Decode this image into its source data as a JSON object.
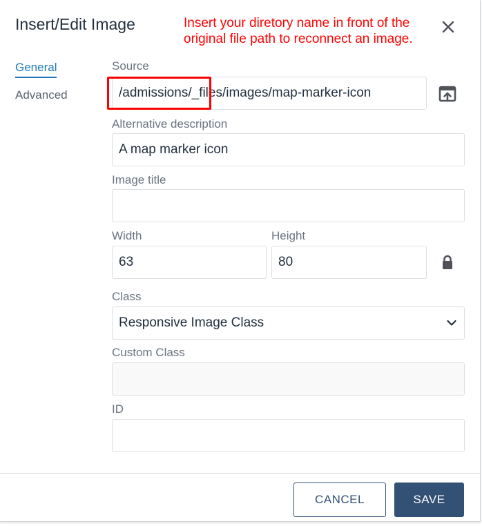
{
  "dialog": {
    "title": "Insert/Edit Image",
    "close_icon": "close-icon"
  },
  "annotation": {
    "text": "Insert your diretory name in front of the original file path to reconnect an image.",
    "color": "#ff0000"
  },
  "tabs": [
    {
      "label": "General",
      "active": true
    },
    {
      "label": "Advanced",
      "active": false
    }
  ],
  "form": {
    "source": {
      "label": "Source",
      "value": "/admissions/_files/images/map-marker-icon",
      "browse_icon": "upload-icon"
    },
    "alt": {
      "label": "Alternative description",
      "value": "A map marker icon"
    },
    "title": {
      "label": "Image title",
      "value": ""
    },
    "width": {
      "label": "Width",
      "value": "63"
    },
    "height": {
      "label": "Height",
      "value": "80"
    },
    "constrain_icon": "lock-icon",
    "class": {
      "label": "Class",
      "value": "Responsive Image Class"
    },
    "custom_class": {
      "label": "Custom Class",
      "value": ""
    },
    "id": {
      "label": "ID",
      "value": ""
    }
  },
  "footer": {
    "cancel_label": "CANCEL",
    "save_label": "SAVE"
  },
  "colors": {
    "accent": "#207ab7",
    "primary_button": "#335075",
    "text": "#222f3e",
    "label": "#6b7480"
  }
}
